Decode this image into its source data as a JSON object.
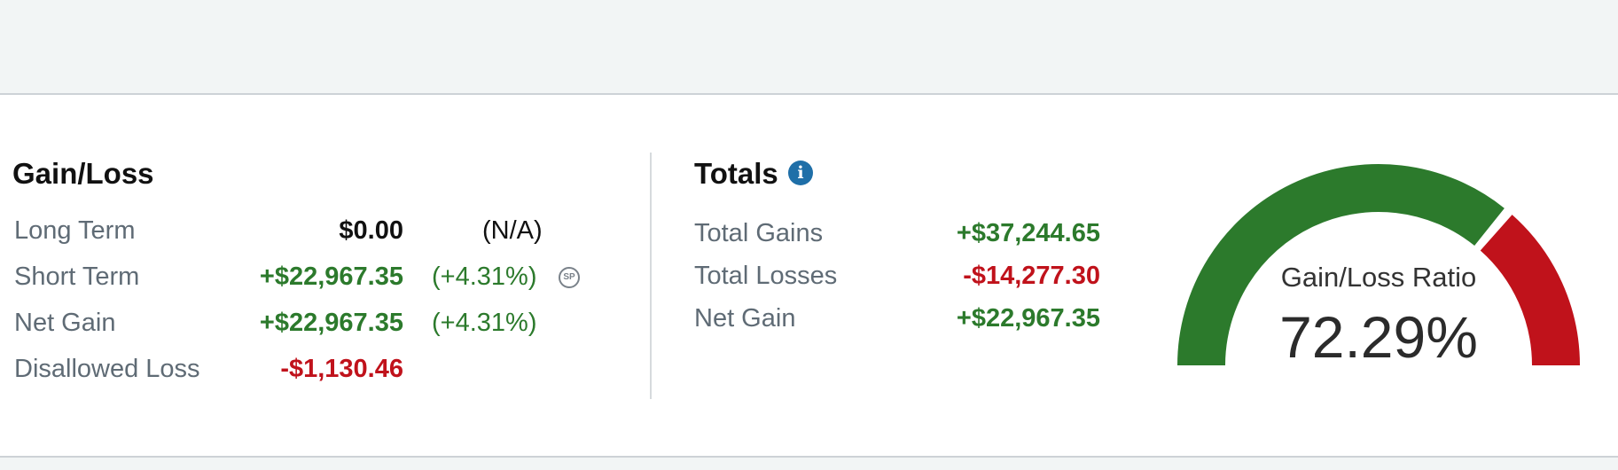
{
  "gain_loss": {
    "title": "Gain/Loss",
    "rows": [
      {
        "label": "Long Term",
        "value": "$0.00",
        "pct": "(N/A)"
      },
      {
        "label": "Short Term",
        "value": "+$22,967.35",
        "pct": "(+4.31%)"
      },
      {
        "label": "Net Gain",
        "value": "+$22,967.35",
        "pct": "(+4.31%)"
      },
      {
        "label": "Disallowed Loss",
        "value": "-$1,130.46",
        "pct": ""
      }
    ]
  },
  "totals": {
    "title": "Totals",
    "info_icon": "info-icon",
    "rows": [
      {
        "label": "Total Gains",
        "value": "+$37,244.65"
      },
      {
        "label": "Total Losses",
        "value": "-$14,277.30"
      },
      {
        "label": "Net Gain",
        "value": "+$22,967.35"
      }
    ]
  },
  "sp_badge": {
    "icon": "sp-badge-icon",
    "text": "SP"
  },
  "gauge": {
    "label": "Gain/Loss Ratio",
    "value_text": "72.29%",
    "ratio": 0.7229,
    "gain_color": "#2c7a2c",
    "loss_color": "#c0121b"
  },
  "colors": {
    "positive": "#2c7a2c",
    "negative": "#c0121b",
    "info": "#1f6fa8"
  }
}
